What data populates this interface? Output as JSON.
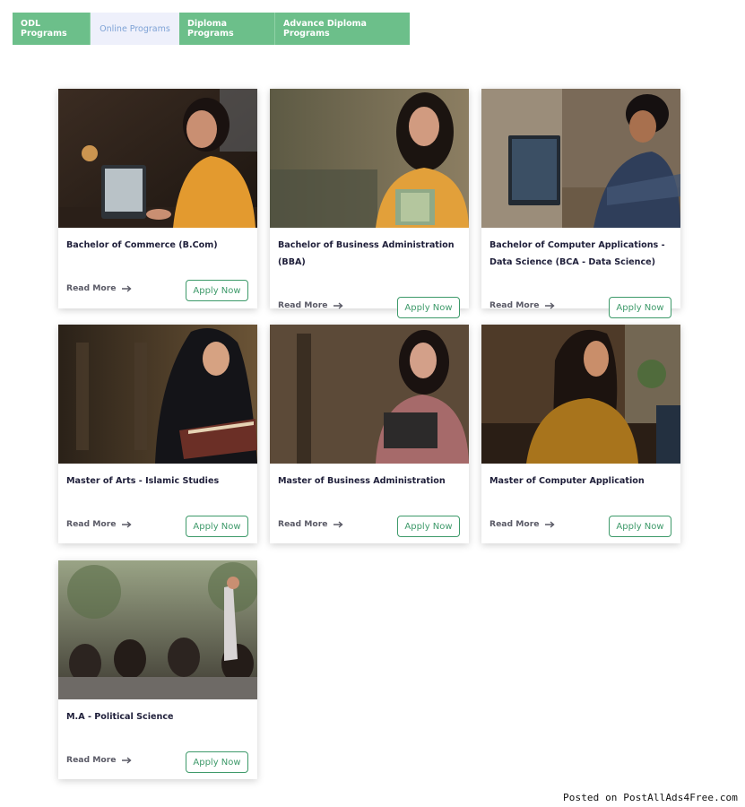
{
  "tabs": [
    {
      "label": "ODL Programs",
      "active": false
    },
    {
      "label": "Online Programs",
      "active": true
    },
    {
      "label": "Diploma Programs",
      "active": false
    },
    {
      "label": "Advance Diploma Programs",
      "active": false
    }
  ],
  "cards": [
    {
      "title": "Bachelor of Commerce (B.Com)",
      "read_more": "Read More",
      "apply": "Apply Now"
    },
    {
      "title": "Bachelor of Business Administration (BBA)",
      "read_more": "Read More",
      "apply": "Apply Now"
    },
    {
      "title": "Bachelor of Computer Applications - Data Science (BCA - Data Science)",
      "read_more": "Read More",
      "apply": "Apply Now"
    },
    {
      "title": "Master of Arts - Islamic Studies",
      "read_more": "Read More",
      "apply": "Apply Now"
    },
    {
      "title": "Master of Business Administration",
      "read_more": "Read More",
      "apply": "Apply Now"
    },
    {
      "title": "Master of Computer Application",
      "read_more": "Read More",
      "apply": "Apply Now"
    },
    {
      "title": "M.A - Political Science",
      "read_more": "Read More",
      "apply": "Apply Now"
    }
  ],
  "watermark": "Posted on PostAllAds4Free.com",
  "colors": {
    "accent": "#6cbf8a",
    "apply_border": "#3e9a6a",
    "active_tab_bg": "#eef0fb"
  }
}
